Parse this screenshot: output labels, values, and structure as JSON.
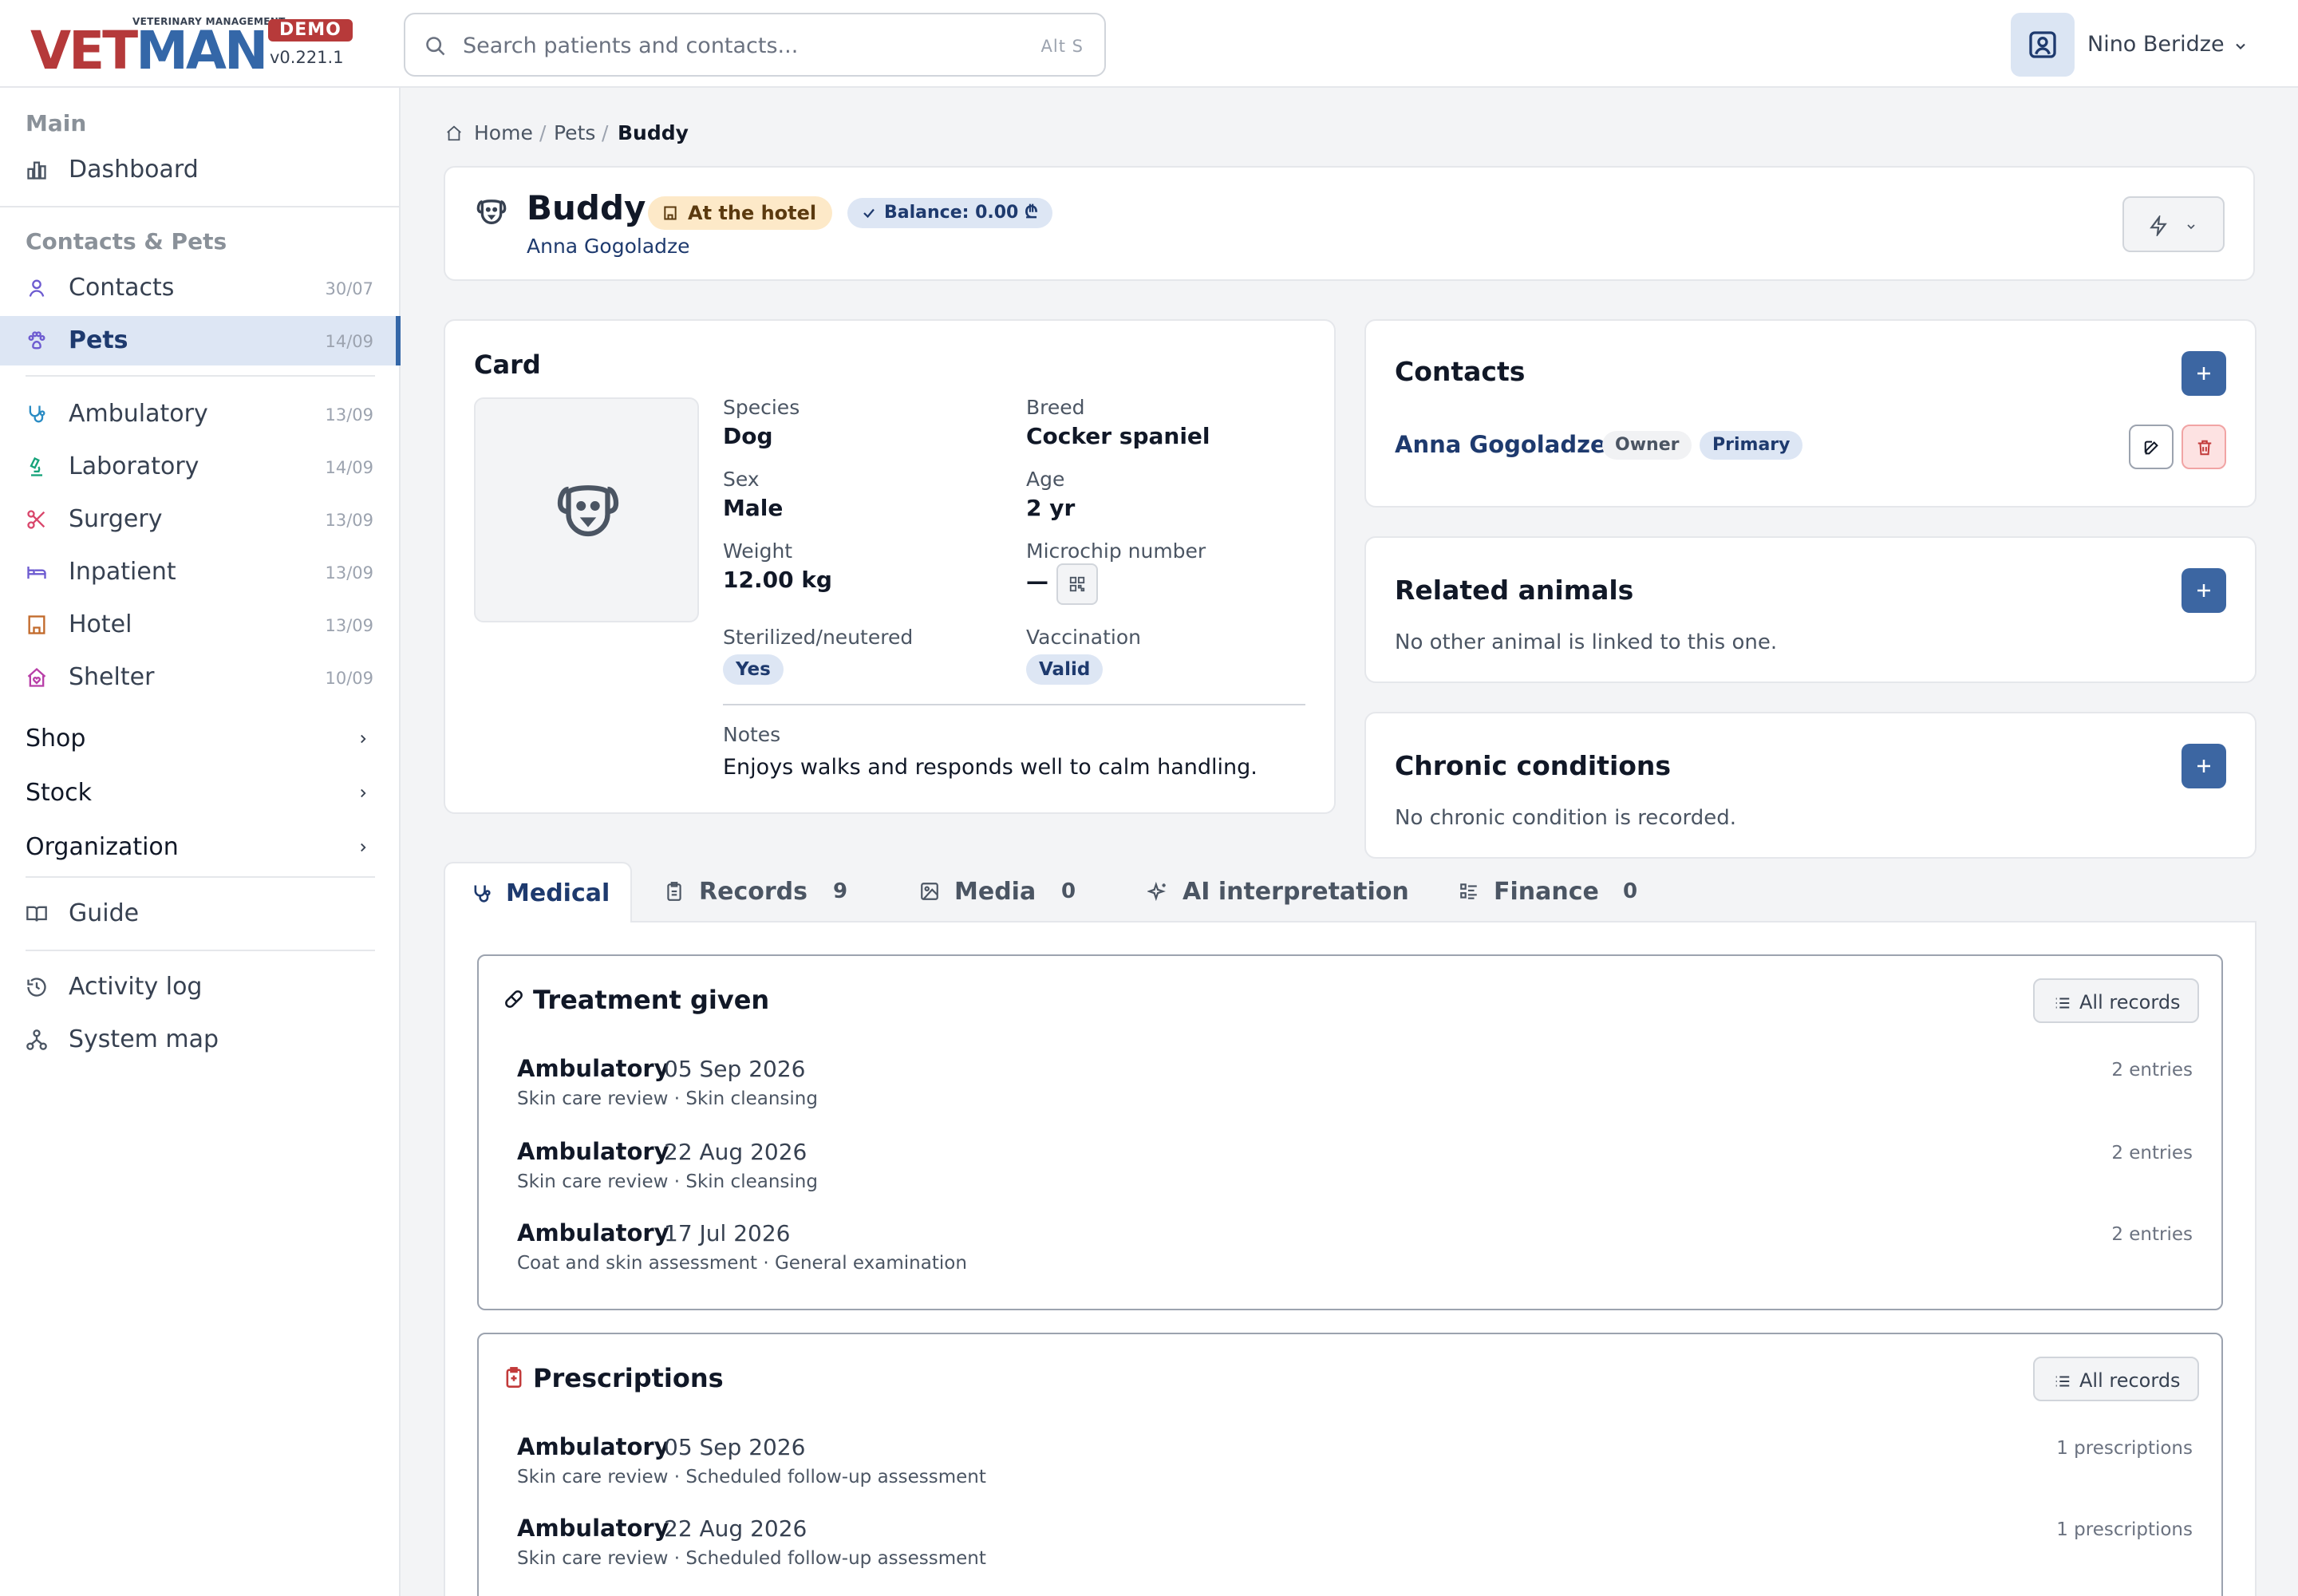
{
  "app": {
    "logo_tagline": "VETERINARY MANAGEMENT",
    "logo_vet": "VET",
    "logo_man": "MAN",
    "demo_badge": "DEMO",
    "version": "v0.221.1"
  },
  "search": {
    "placeholder": "Search patients and contacts...",
    "shortcut": "Alt S"
  },
  "user": {
    "name": "Nino Beridze"
  },
  "sidebar": {
    "main_heading": "Main",
    "dashboard": "Dashboard",
    "contacts_pets_heading": "Contacts & Pets",
    "items": [
      {
        "label": "Contacts",
        "count": "30/07"
      },
      {
        "label": "Pets",
        "count": "14/09"
      },
      {
        "label": "Ambulatory",
        "count": "13/09"
      },
      {
        "label": "Laboratory",
        "count": "14/09"
      },
      {
        "label": "Surgery",
        "count": "13/09"
      },
      {
        "label": "Inpatient",
        "count": "13/09"
      },
      {
        "label": "Hotel",
        "count": "13/09"
      },
      {
        "label": "Shelter",
        "count": "10/09"
      }
    ],
    "groups": [
      "Shop",
      "Stock",
      "Organization"
    ],
    "guide": "Guide",
    "activity_log": "Activity log",
    "system_map": "System map"
  },
  "breadcrumb": {
    "home": "Home",
    "pets": "Pets",
    "current": "Buddy"
  },
  "pet": {
    "name": "Buddy",
    "status": "At the hotel",
    "balance": "Balance: 0.00 ₾",
    "owner": "Anna Gogoladze"
  },
  "card": {
    "title": "Card",
    "species_label": "Species",
    "species": "Dog",
    "breed_label": "Breed",
    "breed": "Cocker spaniel",
    "sex_label": "Sex",
    "sex": "Male",
    "age_label": "Age",
    "age": "2 yr",
    "weight_label": "Weight",
    "weight": "12.00 kg",
    "microchip_label": "Microchip number",
    "microchip": "—",
    "sterilized_label": "Sterilized/neutered",
    "sterilized": "Yes",
    "vaccination_label": "Vaccination",
    "vaccination": "Valid",
    "notes_label": "Notes",
    "notes": "Enjoys walks and responds well to calm handling."
  },
  "contacts": {
    "title": "Contacts",
    "name": "Anna Gogoladze",
    "role": "Owner",
    "primary": "Primary"
  },
  "related": {
    "title": "Related animals",
    "empty": "No other animal is linked to this one."
  },
  "chronic": {
    "title": "Chronic conditions",
    "empty": "No chronic condition is recorded."
  },
  "tabs": [
    {
      "label": "Medical",
      "count": ""
    },
    {
      "label": "Records",
      "count": "9"
    },
    {
      "label": "Media",
      "count": "0"
    },
    {
      "label": "AI interpretation",
      "count": ""
    },
    {
      "label": "Finance",
      "count": "0"
    }
  ],
  "treatment": {
    "title": "Treatment given",
    "all_records": "All records",
    "rows": [
      {
        "type": "Ambulatory",
        "date": "05 Sep 2026",
        "sub": "Skin care review · Skin cleansing",
        "entries": "2 entries"
      },
      {
        "type": "Ambulatory",
        "date": "22 Aug 2026",
        "sub": "Skin care review · Skin cleansing",
        "entries": "2 entries"
      },
      {
        "type": "Ambulatory",
        "date": "17 Jul 2026",
        "sub": "Coat and skin assessment · General examination",
        "entries": "2 entries"
      }
    ]
  },
  "prescriptions": {
    "title": "Prescriptions",
    "all_records": "All records",
    "rows": [
      {
        "type": "Ambulatory",
        "date": "05 Sep 2026",
        "sub": "Skin care review · Scheduled follow-up assessment",
        "entries": "1 prescriptions"
      },
      {
        "type": "Ambulatory",
        "date": "22 Aug 2026",
        "sub": "Skin care review · Scheduled follow-up assessment",
        "entries": "1 prescriptions"
      }
    ]
  },
  "colors": {
    "brand_red": "#b5393a",
    "brand_blue": "#3467a8",
    "accent": "#3c66a2",
    "hotel_badge": "#fde9c8"
  }
}
